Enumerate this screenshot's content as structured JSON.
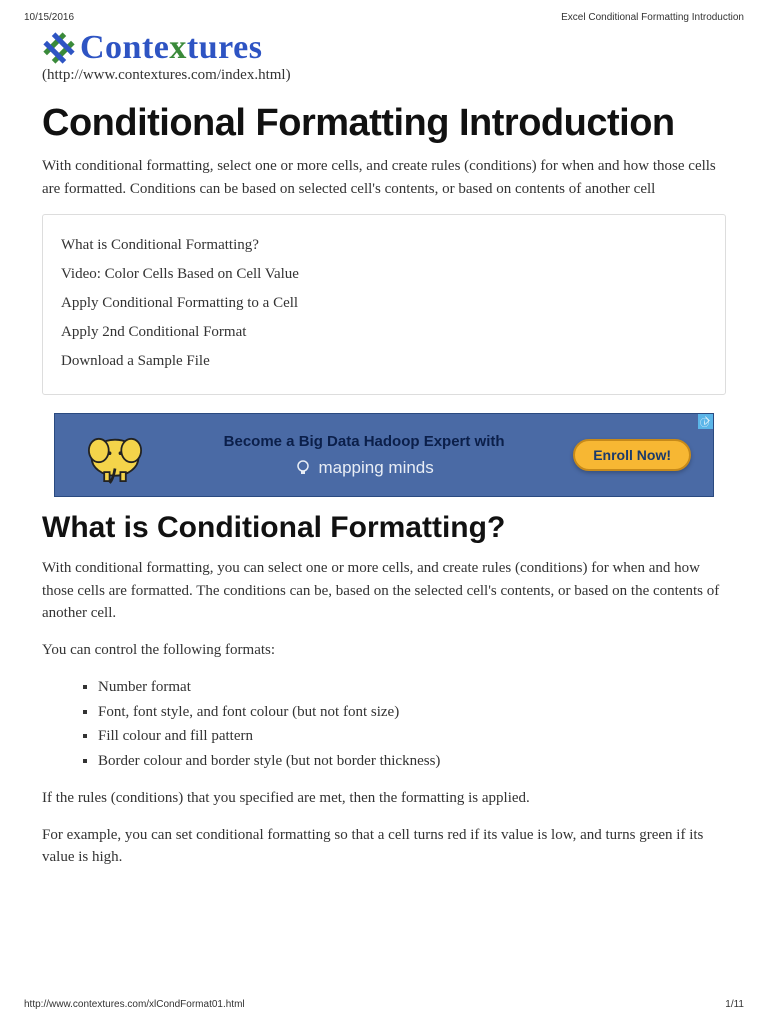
{
  "header": {
    "date": "10/15/2016",
    "doc_title": "Excel Conditional Formatting Introduction"
  },
  "logo": {
    "pre": "Conte",
    "x": "x",
    "post": "tures",
    "url_line": "(http://www.contextures.com/index.html)"
  },
  "page": {
    "title": "Conditional Formatting Introduction",
    "intro": "With conditional formatting, select one or more cells, and create rules (conditions) for when and how those cells are formatted. Conditions can be based on selected cell's contents, or based on contents of another cell"
  },
  "toc": {
    "items": [
      "What is Conditional Formatting?",
      "Video: Color Cells Based on Cell Value",
      "Apply Conditional Formatting to a Cell",
      "Apply 2nd Conditional Format",
      "Download a Sample File"
    ]
  },
  "ad": {
    "line1": "Become a Big Data Hadoop Expert with",
    "line2": "mapping minds",
    "button": "Enroll Now!"
  },
  "section": {
    "title": "What is Conditional Formatting?",
    "p1": "With conditional formatting, you can select one or more cells, and create rules (conditions) for when and how those cells are formatted. The conditions can be, based on the selected cell's contents, or based on the contents of another cell.",
    "p2": "You can control the following formats:",
    "formats": [
      "Number format",
      "Font, font style, and font colour (but not font size)",
      "Fill colour and fill pattern",
      "Border colour and border style (but not border thickness)"
    ],
    "p3": "If the rules (conditions) that you specified are met, then the formatting is applied.",
    "p4": "For example, you can set conditional formatting so that a cell turns red if its value is low, and turns green if its value is high."
  },
  "footer": {
    "url": "http://www.contextures.com/xlCondFormat01.html",
    "page_num": "1/11"
  }
}
